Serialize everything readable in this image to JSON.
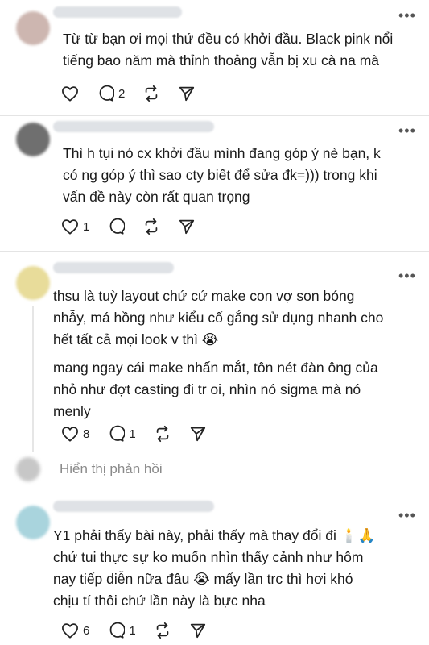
{
  "comments": [
    {
      "avatar_color": "#cdb6b0",
      "lines": [
        "Từ từ bạn ơi mọi thứ đều có khởi đầu. Black pink nổi",
        "tiếng bao năm mà thỉnh thoảng vẫn bị xu cà na mà"
      ],
      "likes": "",
      "replies": "2",
      "reposts": "",
      "shares": ""
    },
    {
      "avatar_color": "#6f6f6f",
      "lines": [
        "Thì h tụi nó cx khởi đầu mình đang góp ý nè bạn, k",
        "có ng góp ý thì sao cty biết để sửa đk=))) trong khi",
        "vấn đề này còn rất quan trọng"
      ],
      "likes": "1",
      "replies": "",
      "reposts": "",
      "shares": ""
    },
    {
      "avatar_color": "#e8dc9a",
      "lines": [
        "thsu là tuỳ layout chứ cứ make con vợ son bóng",
        "nhẫy, má hồng như kiểu cố gắng sử dụng nhanh cho",
        "hết tất cả mọi look v thì 😭"
      ],
      "lines2": [
        "mang ngay cái make nhấn mắt, tôn nét đàn ông của",
        "nhỏ như đợt casting đi tr oi, nhìn nó sigma mà nó",
        "menly"
      ],
      "likes": "8",
      "replies": "1",
      "reposts": "",
      "shares": ""
    },
    {
      "avatar_color": "#a9d4dd",
      "lines": [
        "Y1 phải thấy bài này, phải thấy mà thay đổi đi 🕯️🙏",
        "chứ tui thực sự ko muốn nhìn thấy cảnh như hôm",
        "nay tiếp diễn nữa đâu 😭 mấy lần trc thì hơi khó",
        "chịu tí thôi chứ lần này là bực nha"
      ],
      "likes": "6",
      "replies": "1",
      "reposts": "",
      "shares": ""
    }
  ],
  "show_replies_label": "Hiển thị phản hồi",
  "more_icon": "•••",
  "icons": {
    "like": "heart-icon",
    "reply": "comment-icon",
    "repost": "repost-icon",
    "share": "send-icon"
  }
}
